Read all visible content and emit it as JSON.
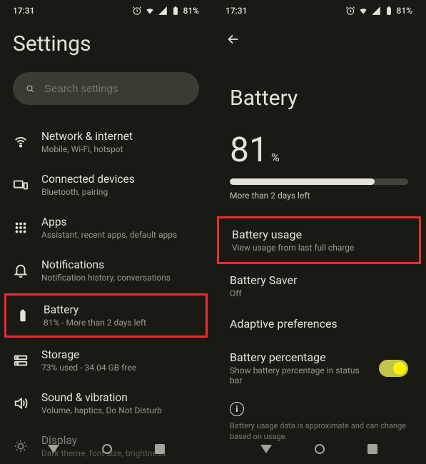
{
  "status": {
    "time": "17:31",
    "battery_pct": "81%"
  },
  "left": {
    "title": "Settings",
    "search_placeholder": "Search settings",
    "items": [
      {
        "icon": "wifi",
        "title": "Network & internet",
        "subtitle": "Mobile, Wi-Fi, hotspot"
      },
      {
        "icon": "devices",
        "title": "Connected devices",
        "subtitle": "Bluetooth, pairing"
      },
      {
        "icon": "apps",
        "title": "Apps",
        "subtitle": "Assistant, recent apps, default apps"
      },
      {
        "icon": "bell",
        "title": "Notifications",
        "subtitle": "Notification history, conversations"
      },
      {
        "icon": "battery",
        "title": "Battery",
        "subtitle": "81% - More than 2 days left",
        "highlight": true
      },
      {
        "icon": "storage",
        "title": "Storage",
        "subtitle": "73% used - 34.04 GB free"
      },
      {
        "icon": "sound",
        "title": "Sound & vibration",
        "subtitle": "Volume, haptics, Do Not Disturb"
      },
      {
        "icon": "display",
        "title": "Display",
        "subtitle": "Dark theme, font size, brightness"
      }
    ]
  },
  "right": {
    "title": "Battery",
    "pct_num": "81",
    "pct_sym": "%",
    "bar_fill_pct": 81,
    "bar_label": "More than 2 days left",
    "options": [
      {
        "title": "Battery usage",
        "subtitle": "View usage from last full charge",
        "highlight": true
      },
      {
        "title": "Battery Saver",
        "subtitle": "Off"
      },
      {
        "title": "Adaptive preferences",
        "subtitle": ""
      },
      {
        "title": "Battery percentage",
        "subtitle": "Show battery percentage in status bar",
        "toggle": true
      }
    ],
    "footnote": "Battery usage data is approximate and can change based on usage."
  }
}
